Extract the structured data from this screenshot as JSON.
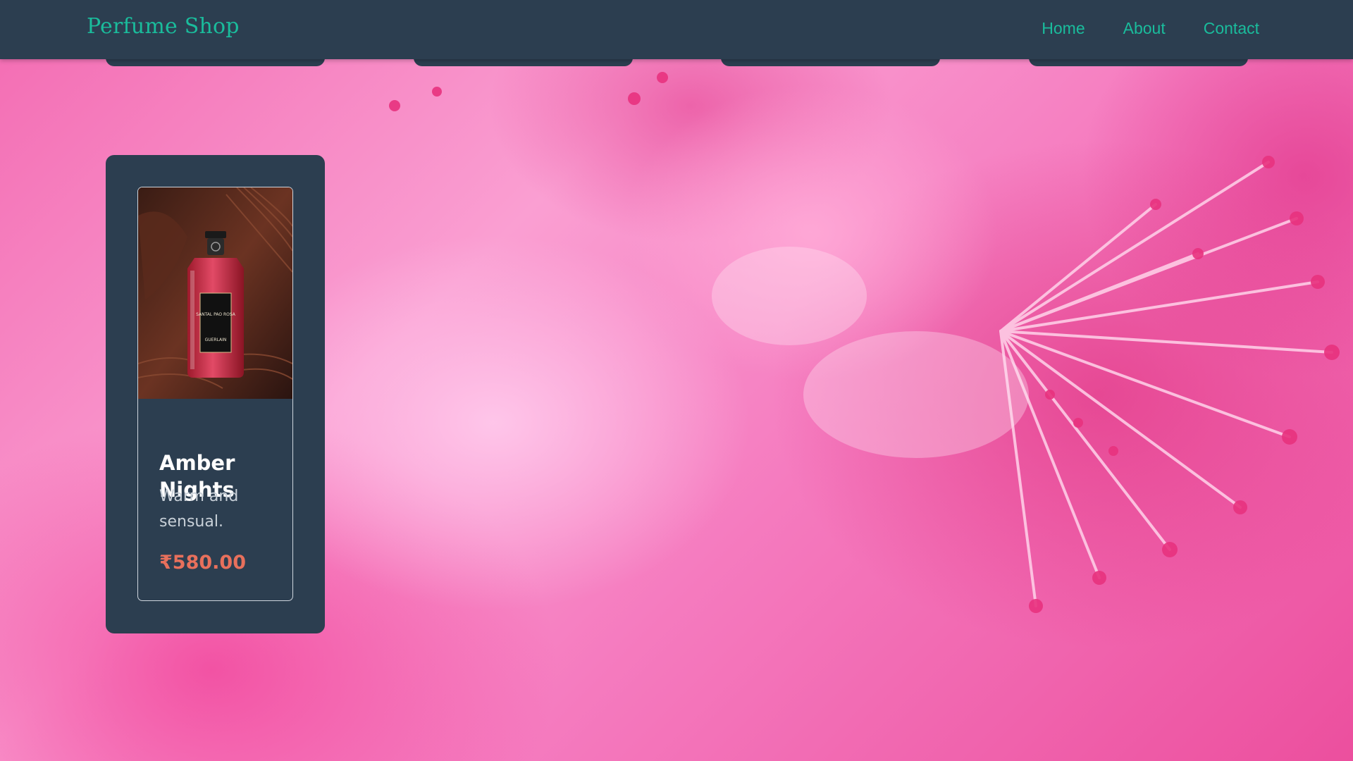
{
  "header": {
    "brand": "Perfume Shop",
    "nav": [
      {
        "label": "Home"
      },
      {
        "label": "About"
      },
      {
        "label": "Contact"
      }
    ]
  },
  "products": [
    {
      "name": "Amber Nights",
      "description": "Warm and sensual.",
      "price": "₹580.00",
      "image_bottle_label": "SANTAL PAO ROSA",
      "image_brand_label": "GUERLAIN"
    }
  ],
  "colors": {
    "navbar": "#2c3e50",
    "accent": "#1abc9c",
    "price": "#e8705c",
    "card": "#2c3e50"
  }
}
